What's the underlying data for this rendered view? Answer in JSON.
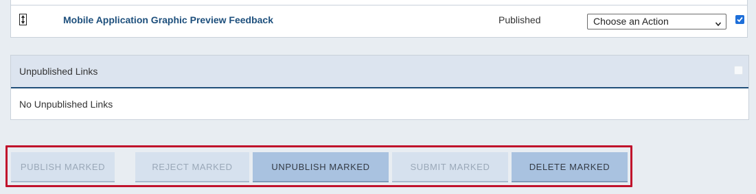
{
  "published_row": {
    "title": "Mobile Application Graphic Preview Feedback",
    "status": "Published",
    "action_select": {
      "selected": "Choose an Action"
    },
    "checked": true
  },
  "unpublished": {
    "header": "Unpublished Links",
    "empty_message": "No Unpublished Links"
  },
  "actions": {
    "publish": "PUBLISH MARKED",
    "reject": "REJECT MARKED",
    "unpublish": "UNPUBLISH MARKED",
    "submit": "SUBMIT MARKED",
    "delete": "DELETE MARKED"
  },
  "colors": {
    "highlight": "#c0112b",
    "link": "#1d4f7c",
    "header_bg": "#dce4ef",
    "enabled_button": "#a9c2e0",
    "disabled_button": "#d6e1ee"
  }
}
